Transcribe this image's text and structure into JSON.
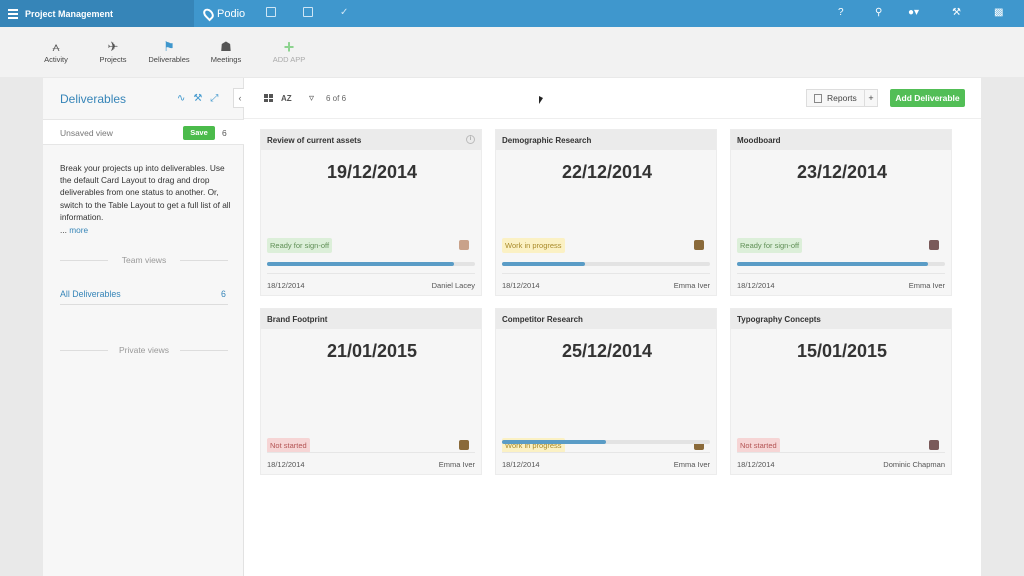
{
  "topbar": {
    "workspace": "Project Management",
    "brand": "Podio"
  },
  "apps": [
    {
      "label": "Activity",
      "icon": "activity-icon",
      "glyph": "⩜"
    },
    {
      "label": "Projects",
      "icon": "rocket-icon",
      "glyph": "✈"
    },
    {
      "label": "Deliverables",
      "icon": "flag-icon",
      "glyph": "⚑"
    },
    {
      "label": "Meetings",
      "icon": "meeting-icon",
      "glyph": "☗"
    },
    {
      "label": "ADD APP",
      "icon": "plus-icon",
      "glyph": "+"
    }
  ],
  "sidebar": {
    "title": "Deliverables",
    "view_name": "Unsaved view",
    "save_label": "Save",
    "view_count": "6",
    "description": "Break your projects up into deliverables. Use the default Card Layout to drag and drop deliverables from one status to another. Or, switch to the Table Layout to get a full list of all information.",
    "more_prefix": "...",
    "more_label": "more",
    "team_views_label": "Team views",
    "all_label": "All Deliverables",
    "all_count": "6",
    "private_views_label": "Private views"
  },
  "toolbar": {
    "sort_label": "AZ",
    "filter_count": "6 of 6",
    "reports_label": "Reports",
    "plus_label": "+",
    "add_label": "Add Deliverable"
  },
  "cards": [
    {
      "title": "Review of current assets",
      "date": "19/12/2014",
      "status": "Ready for sign-off",
      "status_color": "green",
      "progress": 0.9,
      "created": "18/12/2014",
      "owner": "Daniel Lacey"
    },
    {
      "title": "Demographic Research",
      "date": "22/12/2014",
      "status": "Work in progress",
      "status_color": "yellow",
      "progress": 0.4,
      "created": "18/12/2014",
      "owner": "Emma Iver"
    },
    {
      "title": "Moodboard",
      "date": "23/12/2014",
      "status": "Ready for sign-off",
      "status_color": "green",
      "progress": 0.92,
      "created": "18/12/2014",
      "owner": "Emma Iver"
    },
    {
      "title": "Brand Footprint",
      "date": "21/01/2015",
      "status": "Not started",
      "status_color": "red",
      "progress": null,
      "created": "18/12/2014",
      "owner": "Emma Iver"
    },
    {
      "title": "Competitor Research",
      "date": "25/12/2014",
      "status": "Work in progress",
      "status_color": "yellow",
      "progress": 0.5,
      "created": "18/12/2014",
      "owner": "Emma Iver"
    },
    {
      "title": "Typography Concepts",
      "date": "15/01/2015",
      "status": "Not started",
      "status_color": "red",
      "progress": null,
      "created": "18/12/2014",
      "owner": "Dominic Chapman"
    }
  ],
  "colors": {
    "brand_blue": "#3f97cd",
    "save_green": "#4bbb4b",
    "add_green": "#52be56",
    "progress_blue": "#5a9cc6"
  }
}
